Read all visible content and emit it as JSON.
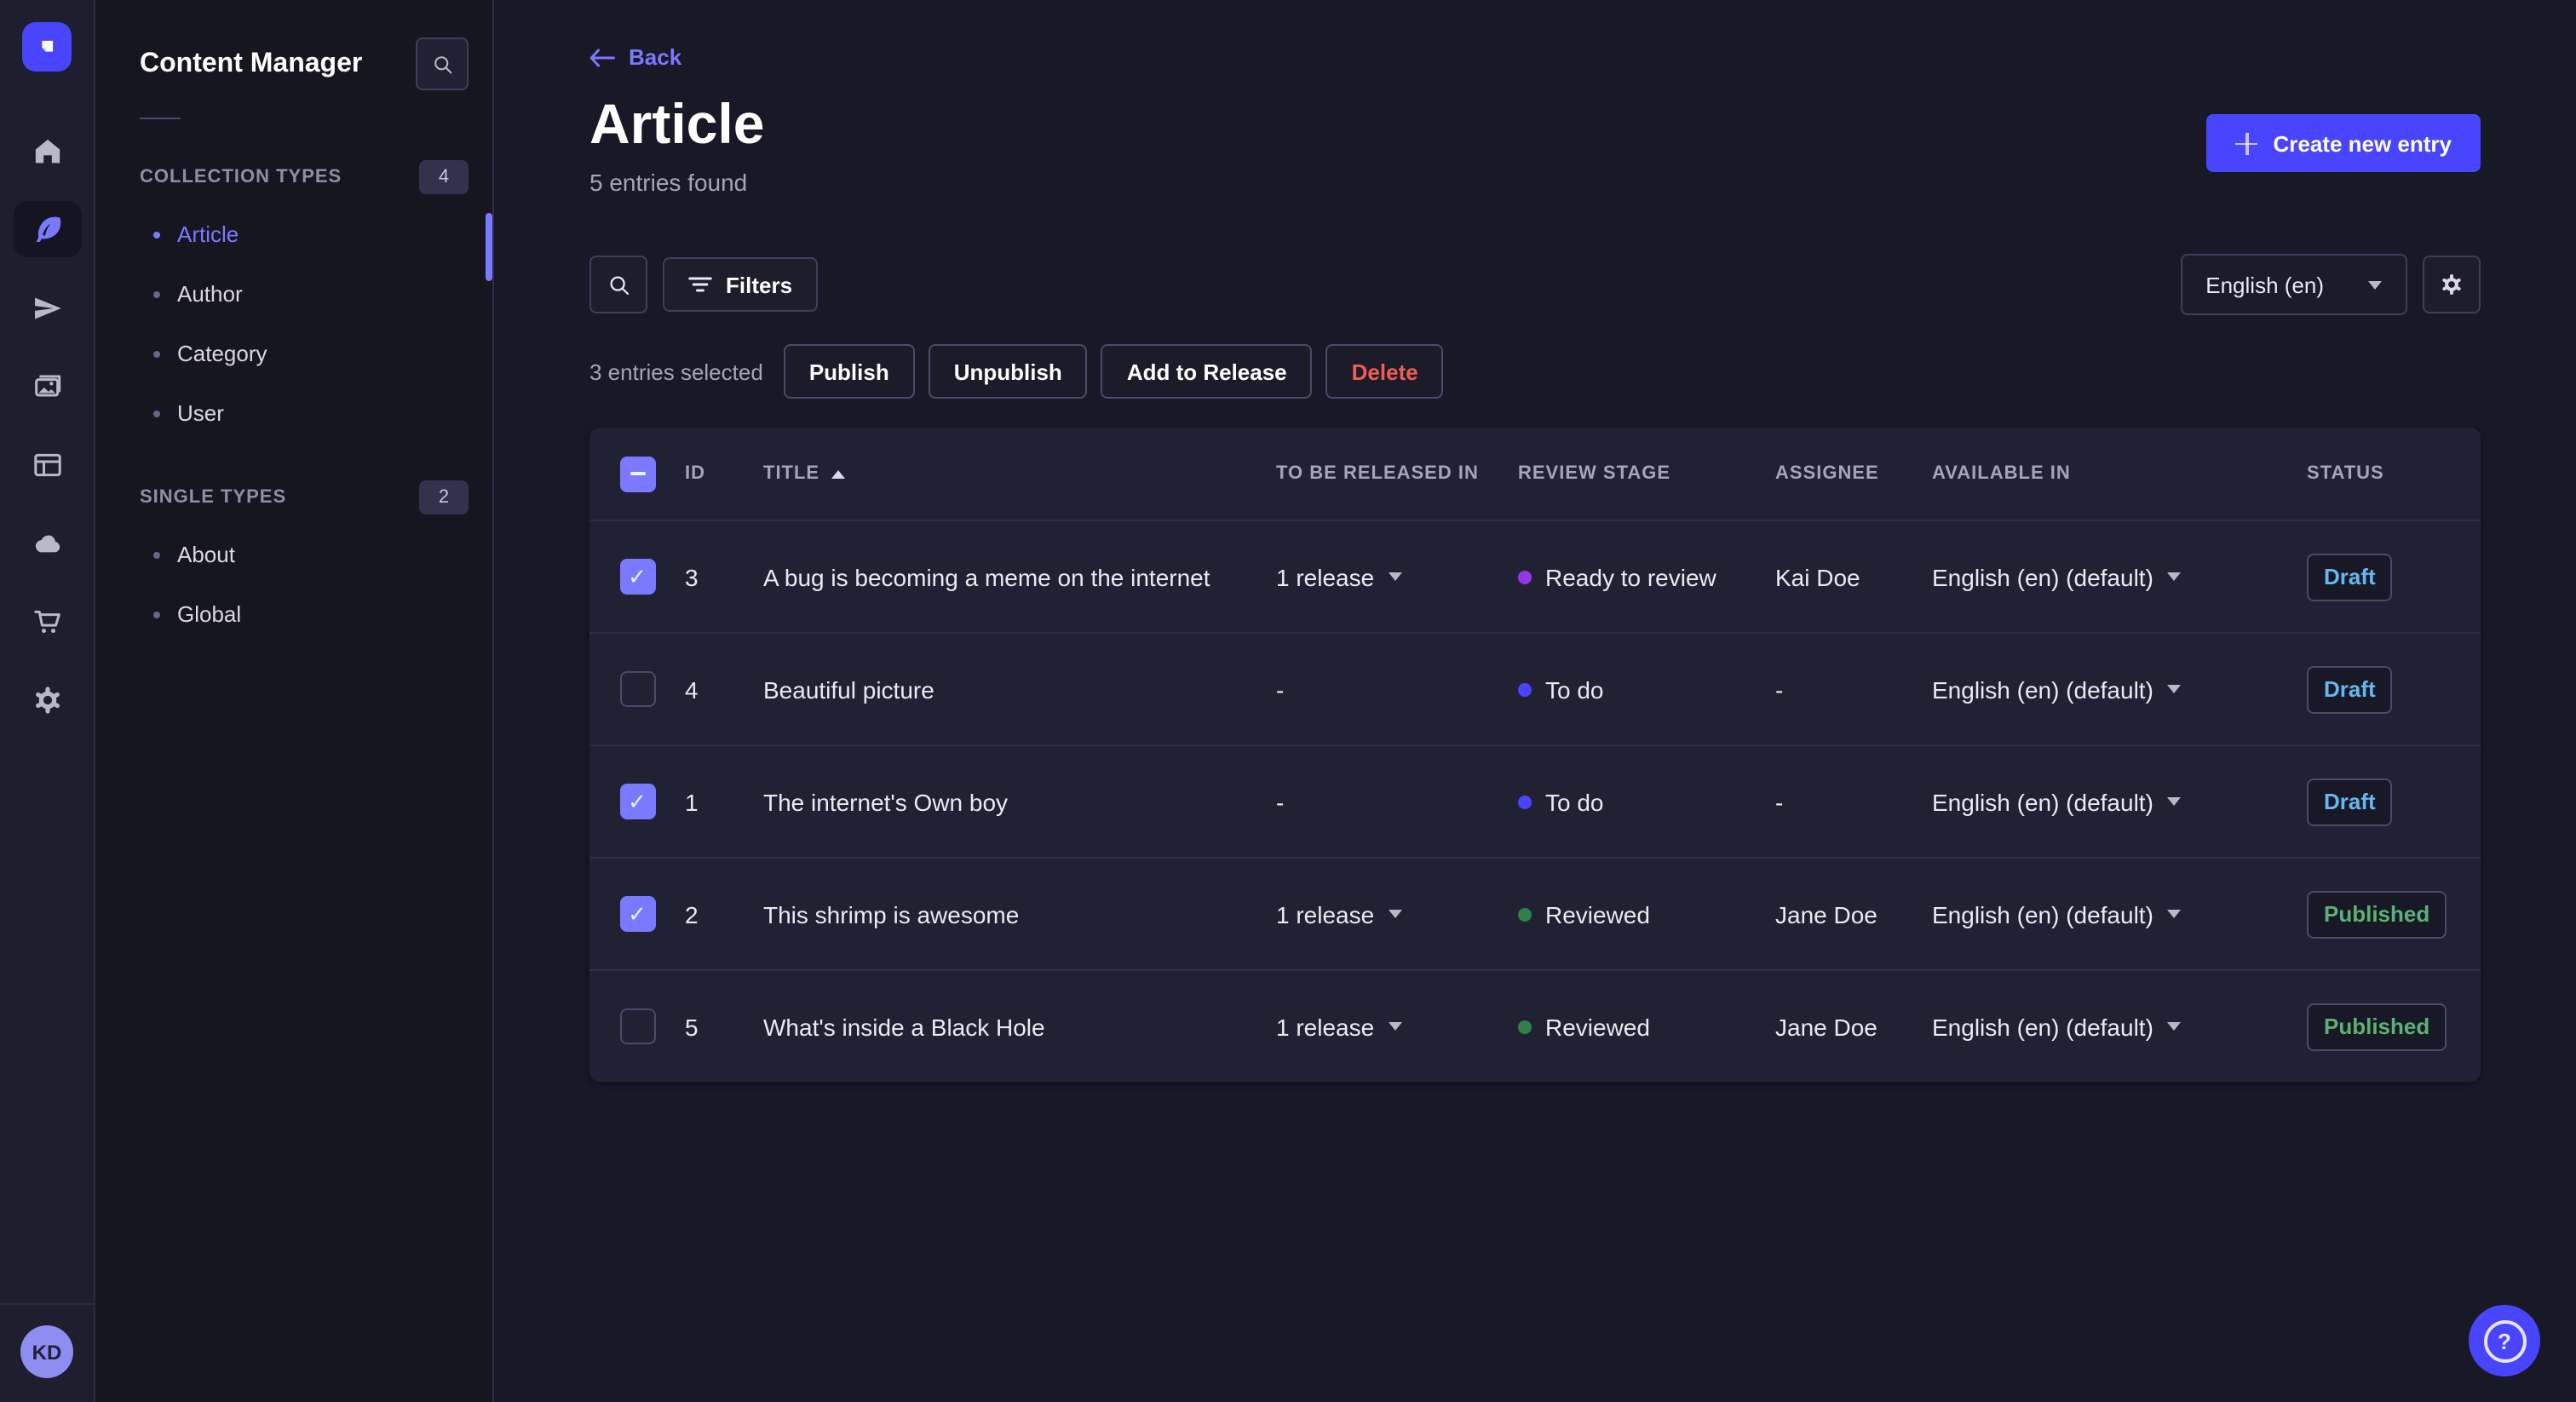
{
  "app_title": "Content Manager",
  "rail": {
    "icons": [
      "home-icon",
      "content-manager-icon",
      "releases-icon",
      "media-library-icon",
      "content-type-builder-icon",
      "deploy-icon",
      "marketplace-icon",
      "settings-icon"
    ],
    "active_icon": "content-manager-icon",
    "avatar_initials": "KD"
  },
  "subnav": {
    "title": "Content Manager",
    "search_icon": "search-icon",
    "sections": [
      {
        "label": "COLLECTION TYPES",
        "count": "4",
        "items": [
          {
            "label": "Article",
            "active": true
          },
          {
            "label": "Author"
          },
          {
            "label": "Category"
          },
          {
            "label": "User"
          }
        ]
      },
      {
        "label": "SINGLE TYPES",
        "count": "2",
        "items": [
          {
            "label": "About"
          },
          {
            "label": "Global"
          }
        ]
      }
    ]
  },
  "header": {
    "back_label": "Back",
    "title": "Article",
    "subtitle": "5 entries found",
    "create_button": "Create new entry"
  },
  "toolbar": {
    "search_icon": "search-icon",
    "filters_button": "Filters",
    "locale_select_value": "English (en)",
    "settings_icon": "gear-icon"
  },
  "selection": {
    "text": "3 entries selected",
    "publish": "Publish",
    "unpublish": "Unpublish",
    "add_to_release": "Add to Release",
    "delete": "Delete"
  },
  "table": {
    "header_checkbox": "mixed",
    "headers": [
      "ID",
      "TITLE",
      "TO BE RELEASED IN",
      "REVIEW STAGE",
      "ASSIGNEE",
      "AVAILABLE IN",
      "STATUS"
    ],
    "sort_column": "TITLE",
    "sort_direction": "ascending",
    "rows": [
      {
        "checked": true,
        "id": "3",
        "title": "A bug is becoming a meme on the internet",
        "released_in": "1 release",
        "stage": "Ready to review",
        "stage_color": "#9736e8",
        "assignee": "Kai Doe",
        "locale": "English (en) (default)",
        "status": "Draft"
      },
      {
        "checked": false,
        "id": "4",
        "title": "Beautiful picture",
        "released_in": "-",
        "stage": "To do",
        "stage_color": "#4945ff",
        "assignee": "-",
        "locale": "English (en) (default)",
        "status": "Draft"
      },
      {
        "checked": true,
        "id": "1",
        "title": "The internet's Own boy",
        "released_in": "-",
        "stage": "To do",
        "stage_color": "#4945ff",
        "assignee": "-",
        "locale": "English (en) (default)",
        "status": "Draft"
      },
      {
        "checked": true,
        "id": "2",
        "title": "This shrimp is awesome",
        "released_in": "1 release",
        "stage": "Reviewed",
        "stage_color": "#328048",
        "assignee": "Jane Doe",
        "locale": "English (en) (default)",
        "status": "Published"
      },
      {
        "checked": false,
        "id": "5",
        "title": "What's inside a Black Hole",
        "released_in": "1 release",
        "stage": "Reviewed",
        "stage_color": "#328048",
        "assignee": "Jane Doe",
        "locale": "English (en) (default)",
        "status": "Published"
      }
    ]
  },
  "help": {
    "icon": "question-mark-icon",
    "glyph": "?"
  },
  "colors": {
    "primary": "#4945ff",
    "accent": "#7b79ff",
    "danger": "#ee5e52",
    "success": "#5cb176",
    "draft_status": "#66b7f1",
    "page_bg": "#181826",
    "card_bg": "#212134"
  }
}
